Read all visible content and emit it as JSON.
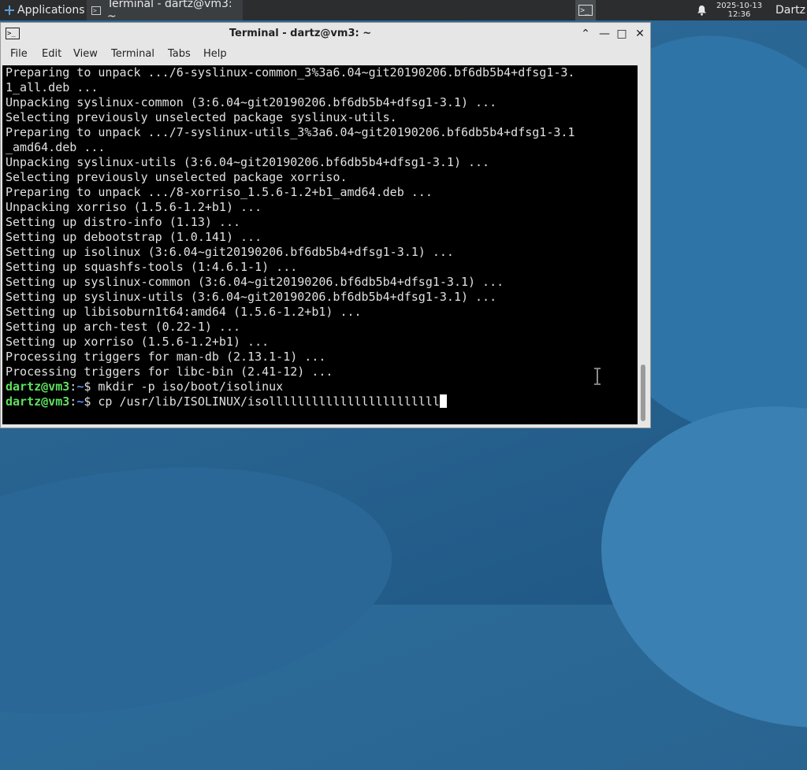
{
  "panel": {
    "applications_label": "Applications",
    "task_label": "Terminal - dartz@vm3: ~",
    "date": "2025-10-13",
    "time": "12:36",
    "user": "Dartz"
  },
  "window": {
    "title": "Terminal - dartz@vm3: ~",
    "menu": [
      "File",
      "Edit",
      "View",
      "Terminal",
      "Tabs",
      "Help"
    ]
  },
  "terminal": {
    "lines": [
      "Preparing to unpack .../6-syslinux-common_3%3a6.04~git20190206.bf6db5b4+dfsg1-3.",
      "1_all.deb ...",
      "Unpacking syslinux-common (3:6.04~git20190206.bf6db5b4+dfsg1-3.1) ...",
      "Selecting previously unselected package syslinux-utils.",
      "Preparing to unpack .../7-syslinux-utils_3%3a6.04~git20190206.bf6db5b4+dfsg1-3.1",
      "_amd64.deb ...",
      "Unpacking syslinux-utils (3:6.04~git20190206.bf6db5b4+dfsg1-3.1) ...",
      "Selecting previously unselected package xorriso.",
      "Preparing to unpack .../8-xorriso_1.5.6-1.2+b1_amd64.deb ...",
      "Unpacking xorriso (1.5.6-1.2+b1) ...",
      "Setting up distro-info (1.13) ...",
      "Setting up debootstrap (1.0.141) ...",
      "Setting up isolinux (3:6.04~git20190206.bf6db5b4+dfsg1-3.1) ...",
      "Setting up squashfs-tools (1:4.6.1-1) ...",
      "Setting up syslinux-common (3:6.04~git20190206.bf6db5b4+dfsg1-3.1) ...",
      "Setting up syslinux-utils (3:6.04~git20190206.bf6db5b4+dfsg1-3.1) ...",
      "Setting up libisoburn1t64:amd64 (1.5.6-1.2+b1) ...",
      "Setting up arch-test (0.22-1) ...",
      "Setting up xorriso (1.5.6-1.2+b1) ...",
      "Processing triggers for man-db (2.13.1-1) ...",
      "Processing triggers for libc-bin (2.41-12) ..."
    ],
    "prompt_user": "dartz@vm3",
    "prompt_sep": ":",
    "prompt_path": "~",
    "prompt_symbol": "$",
    "commands": [
      "mkdir -p iso/boot/isolinux",
      "cp /usr/lib/ISOLINUX/isollllllllllllllllllllllll"
    ]
  }
}
